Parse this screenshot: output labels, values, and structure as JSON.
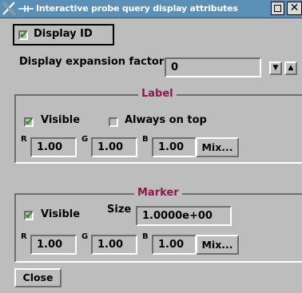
{
  "window": {
    "title": "Interactive probe query display attributes",
    "close_glyph": "✕"
  },
  "display_id": {
    "label": "Display ID",
    "checked": true
  },
  "expansion": {
    "label": "Display expansion factor",
    "value": "0",
    "down_glyph": "▼",
    "up_glyph": "▲"
  },
  "label_group": {
    "title": "Label",
    "visible": {
      "label": "Visible",
      "checked": true
    },
    "always_on_top": {
      "label": "Always on top",
      "checked": false
    },
    "r": {
      "label": "R",
      "value": "1.00"
    },
    "g": {
      "label": "G",
      "value": "1.00"
    },
    "b": {
      "label": "B",
      "value": "1.00"
    },
    "mix_label": "Mix..."
  },
  "marker_group": {
    "title": "Marker",
    "visible": {
      "label": "Visible",
      "checked": true
    },
    "size": {
      "label": "Size",
      "value": "1.0000e+00"
    },
    "r": {
      "label": "R",
      "value": "1.00"
    },
    "g": {
      "label": "G",
      "value": "1.00"
    },
    "b": {
      "label": "B",
      "value": "1.00"
    },
    "mix_label": "Mix..."
  },
  "close_label": "Close",
  "colors": {
    "titlebar": "#5b8fb5",
    "group_title": "#8b1a4a",
    "check": "#228b22",
    "panel": "#bdbdbd"
  }
}
